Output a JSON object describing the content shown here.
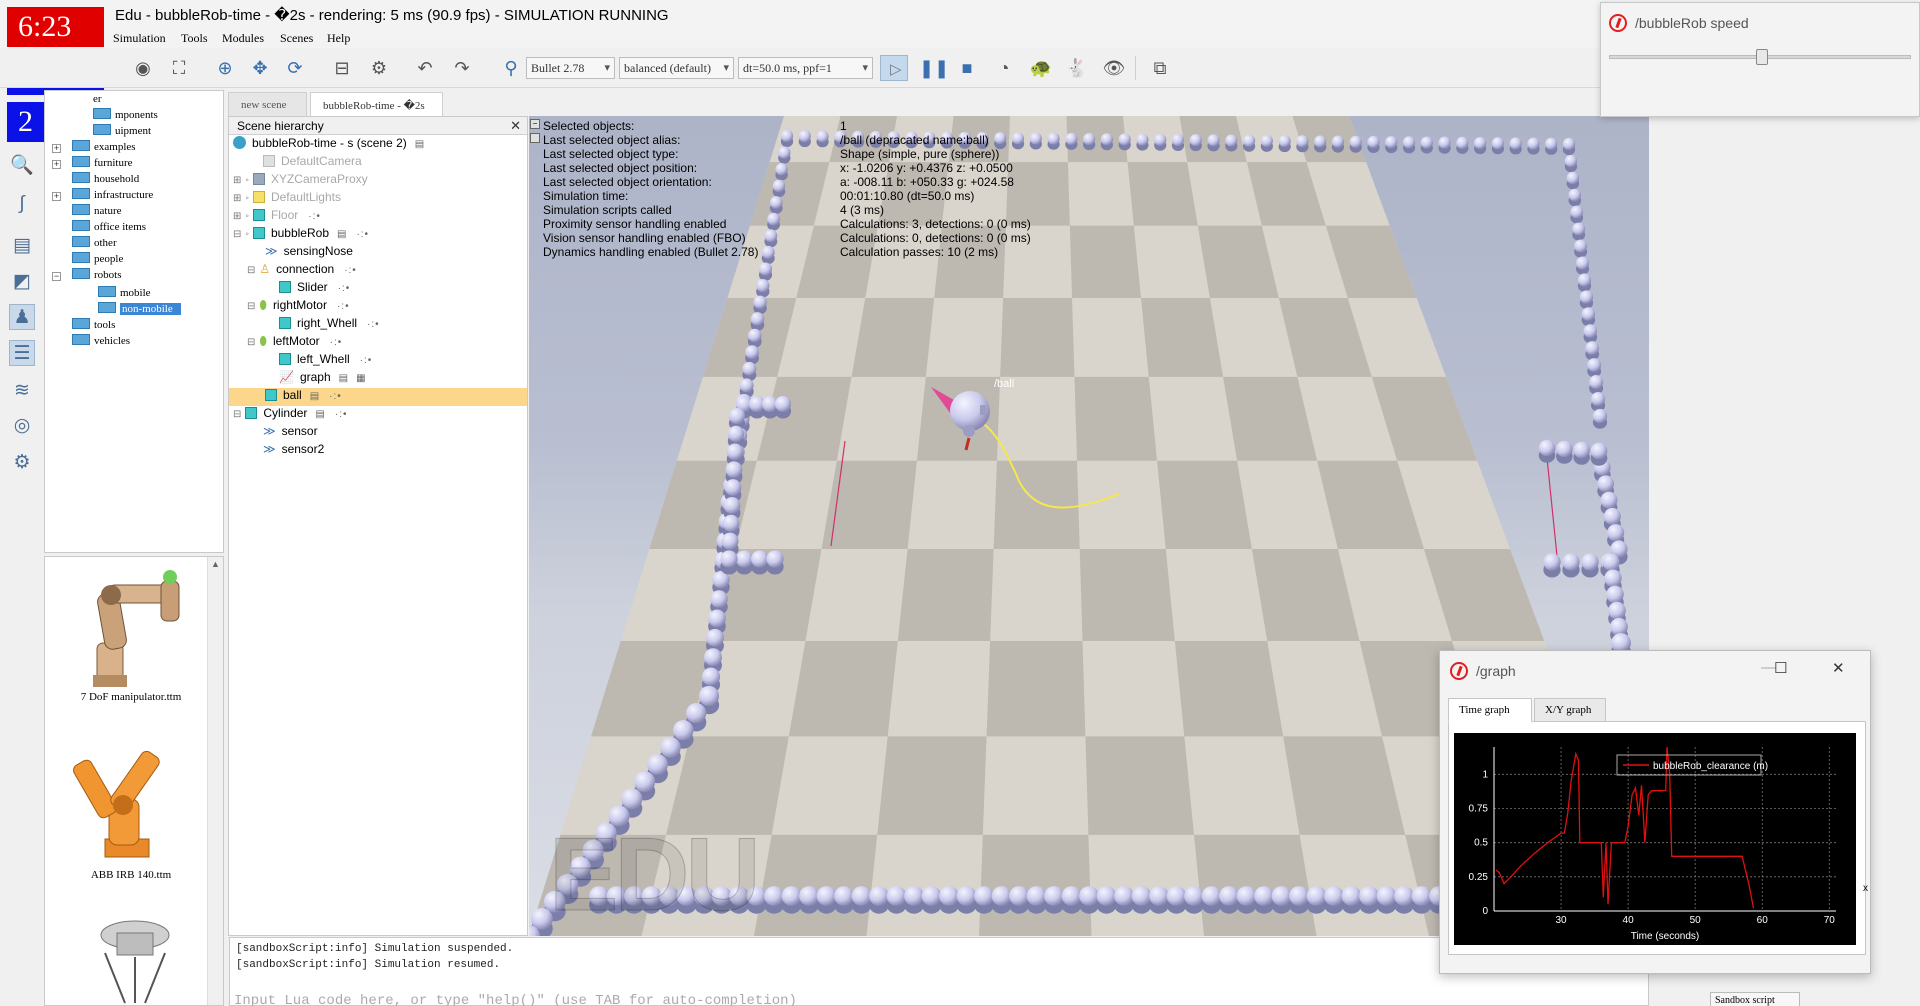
{
  "window": {
    "title": "Edu - bubbleRob-time - �2s - rendering: 5 ms (90.9 fps) - SIMULATION RUNNING"
  },
  "overlay": {
    "timer": "6:23",
    "label1": "1",
    "label2": "2"
  },
  "menu": [
    "Simulation",
    "Tools",
    "Modules",
    "Scenes",
    "Help"
  ],
  "toolbar": {
    "engine": "Bullet 2.78",
    "mode": "balanced (default)",
    "dt": "dt=50.0 ms, ppf=1"
  },
  "browser": {
    "header": "er",
    "items": [
      {
        "label": "mponents"
      },
      {
        "label": "uipment"
      },
      {
        "label": "examples"
      },
      {
        "label": "furniture"
      },
      {
        "label": "household"
      },
      {
        "label": "infrastructure"
      },
      {
        "label": "nature"
      },
      {
        "label": "office items"
      },
      {
        "label": "other"
      },
      {
        "label": "people"
      },
      {
        "label": "robots"
      },
      {
        "label": "mobile"
      },
      {
        "label": "non-mobile"
      },
      {
        "label": "tools"
      },
      {
        "label": "vehicles"
      }
    ],
    "thumbnails": [
      "7 DoF manipulator.ttm",
      "ABB IRB 140.ttm"
    ]
  },
  "scene_tabs": [
    "new scene",
    "bubbleRob-time - �2s"
  ],
  "hierarchy": {
    "title": "Scene hierarchy",
    "close": "✕",
    "root": "bubbleRob-time - s (scene 2)",
    "items": [
      {
        "label": "DefaultCamera"
      },
      {
        "label": "XYZCameraProxy"
      },
      {
        "label": "DefaultLights"
      },
      {
        "label": "Floor"
      },
      {
        "label": "bubbleRob"
      },
      {
        "label": "sensingNose"
      },
      {
        "label": "connection"
      },
      {
        "label": "Slider"
      },
      {
        "label": "rightMotor"
      },
      {
        "label": "right_Whell"
      },
      {
        "label": "leftMotor"
      },
      {
        "label": "left_Whell"
      },
      {
        "label": "graph"
      },
      {
        "label": "ball"
      },
      {
        "label": "Cylinder"
      },
      {
        "label": "sensor"
      },
      {
        "label": "sensor2"
      }
    ]
  },
  "info": {
    "labels": [
      "Selected objects:",
      "Last selected object alias:",
      "Last selected object type:",
      "Last selected object position:",
      "Last selected object orientation:",
      "Simulation time:",
      "Simulation scripts called",
      "Proximity sensor handling enabled",
      "Vision sensor handling enabled (FBO)",
      "Dynamics handling enabled (Bullet 2.78)"
    ],
    "values": [
      "1",
      "/ball    (depracated name:ball)",
      "Shape (simple, pure (sphere))",
      "x: -1.0206    y: +0.4376    z: +0.0500",
      "a: -008.11    b: +050.33    g: +024.58",
      "00:01:10.80 (dt=50.0 ms)",
      "4 (3 ms)",
      "Calculations: 3, detections: 0 (0 ms)",
      "Calculations: 0, detections: 0 (0 ms)",
      "Calculation passes: 10 (2 ms)"
    ],
    "ball_label": "/ball"
  },
  "watermark": "EDU",
  "console": {
    "lines": [
      "[sandboxScript:info] Simulation suspended.",
      "[sandboxScript:info] Simulation resumed."
    ],
    "input_placeholder": "Input Lua code here, or type \"help()\" (use TAB for auto-completion)",
    "script_select": "Sandbox script"
  },
  "speed_window": {
    "title": "/bubbleRob speed",
    "slider_value": 0.42
  },
  "graph_window": {
    "title": "/graph",
    "tabs": [
      "Time graph",
      "X/Y graph"
    ],
    "close_x": "x"
  },
  "chart_data": {
    "type": "line",
    "title": "",
    "xlabel": "Time (seconds)",
    "ylabel": "",
    "xlim": [
      20,
      71
    ],
    "ylim": [
      0,
      1.2
    ],
    "x_ticks": [
      30,
      40,
      50,
      60,
      70
    ],
    "y_ticks": [
      0,
      0.25,
      0.5,
      0.75,
      1
    ],
    "x_tick_labels": [
      "30",
      "40",
      "50",
      "60",
      "70"
    ],
    "y_tick_labels": [
      "0",
      "0.25",
      "0.5",
      "0.75",
      "1"
    ],
    "legend": "top-right",
    "grid": true,
    "series": [
      {
        "name": "bubbleRob_clearance (m)",
        "color": "#e01010",
        "points": [
          [
            20.3,
            0.3
          ],
          [
            20.8,
            0.28
          ],
          [
            21.5,
            0.2
          ],
          [
            22.5,
            0.25
          ],
          [
            24,
            0.33
          ],
          [
            26,
            0.42
          ],
          [
            28,
            0.5
          ],
          [
            30,
            0.57
          ],
          [
            30.5,
            0.57
          ],
          [
            31,
            0.72
          ],
          [
            31.5,
            0.95
          ],
          [
            32.2,
            1.15
          ],
          [
            32.6,
            1.1
          ],
          [
            32.8,
            0.5
          ],
          [
            33.2,
            0.5
          ],
          [
            34,
            0.5
          ],
          [
            35,
            0.5
          ],
          [
            36,
            0.5
          ],
          [
            36.3,
            0.1
          ],
          [
            36.7,
            0.5
          ],
          [
            37,
            0.05
          ],
          [
            37.5,
            0.5
          ],
          [
            38.5,
            0.5
          ],
          [
            39.5,
            0.5
          ],
          [
            40,
            0.62
          ],
          [
            40.6,
            0.85
          ],
          [
            41.1,
            0.9
          ],
          [
            41.6,
            0.7
          ],
          [
            42,
            0.92
          ],
          [
            42.5,
            0.5
          ],
          [
            43,
            0.85
          ],
          [
            43.5,
            0.88
          ],
          [
            44,
            0.88
          ],
          [
            45,
            0.88
          ],
          [
            45.6,
            0.88
          ],
          [
            45.8,
            1.2
          ],
          [
            46.2,
            1.0
          ],
          [
            46.5,
            0.4
          ],
          [
            48,
            0.4
          ],
          [
            50,
            0.4
          ],
          [
            52,
            0.4
          ],
          [
            54,
            0.4
          ],
          [
            56,
            0.4
          ],
          [
            57,
            0.4
          ],
          [
            58,
            0.2
          ],
          [
            58.7,
            0.02
          ]
        ]
      }
    ]
  },
  "colors": {
    "accent_blue": "#3c86d6",
    "highlight_row": "#fcd68a",
    "timer_red": "#e00000",
    "badge_blue": "#0a12e8",
    "wall_spheres": "#c8c8ec",
    "path_yellow": "#f4e84a"
  }
}
